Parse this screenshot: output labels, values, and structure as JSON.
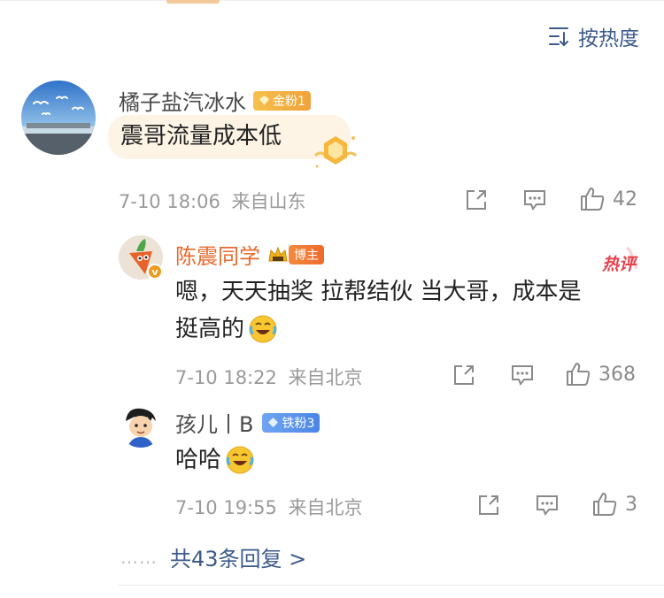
{
  "sort": {
    "label": "按热度"
  },
  "comment": {
    "username": "橘子盐汽冰水",
    "badge": "金粉1",
    "text": "震哥流量成本低",
    "time": "7-10 18:06",
    "location": "来自山东",
    "likes": "42"
  },
  "replies": [
    {
      "username": "陈震同学",
      "badge": "博主",
      "tag": "热评",
      "text_line1": "嗯，天天抽奖  拉帮结伙 当大哥，成本是",
      "text_line2": "挺高的",
      "time": "7-10 18:22",
      "location": "来自北京",
      "likes": "368"
    },
    {
      "username": "孩儿丨B",
      "badge": "铁粉3",
      "text": "哈哈",
      "time": "7-10 19:55",
      "location": "来自北京",
      "likes": "3"
    }
  ],
  "more_replies": {
    "dots": "……",
    "label": "共43条回复 >"
  },
  "colors": {
    "link": "#3c5a8c",
    "meta": "#9a9a9a",
    "blogger": "#e86a2d"
  }
}
